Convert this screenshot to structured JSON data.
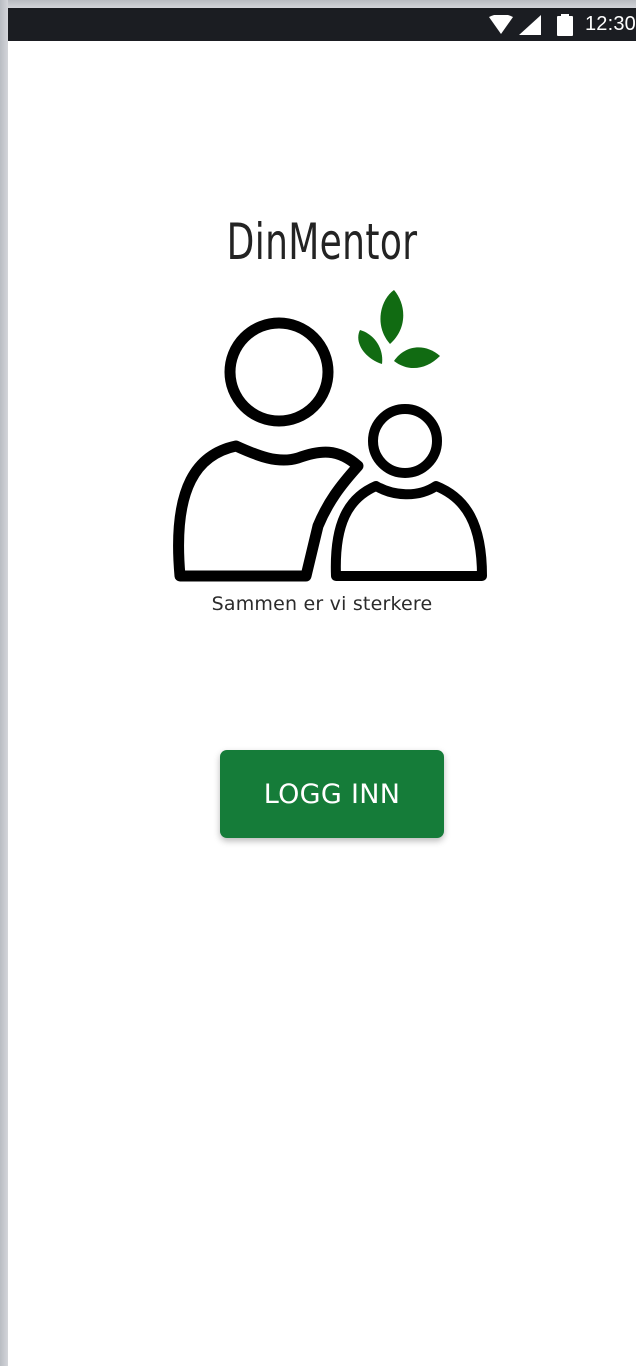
{
  "status_bar": {
    "time": "12:30",
    "icons": [
      "wifi-icon",
      "cellular-signal-icon",
      "battery-icon"
    ]
  },
  "app": {
    "title": "DinMentor",
    "logo": "mentor-mentee-logo",
    "tagline": "Sammen er vi sterkere",
    "login_label": "LOGG INN"
  },
  "colors": {
    "button": "#157c39",
    "leaf": "#116b12",
    "status_bar": "#1b1d22",
    "background": "#ffffff"
  }
}
